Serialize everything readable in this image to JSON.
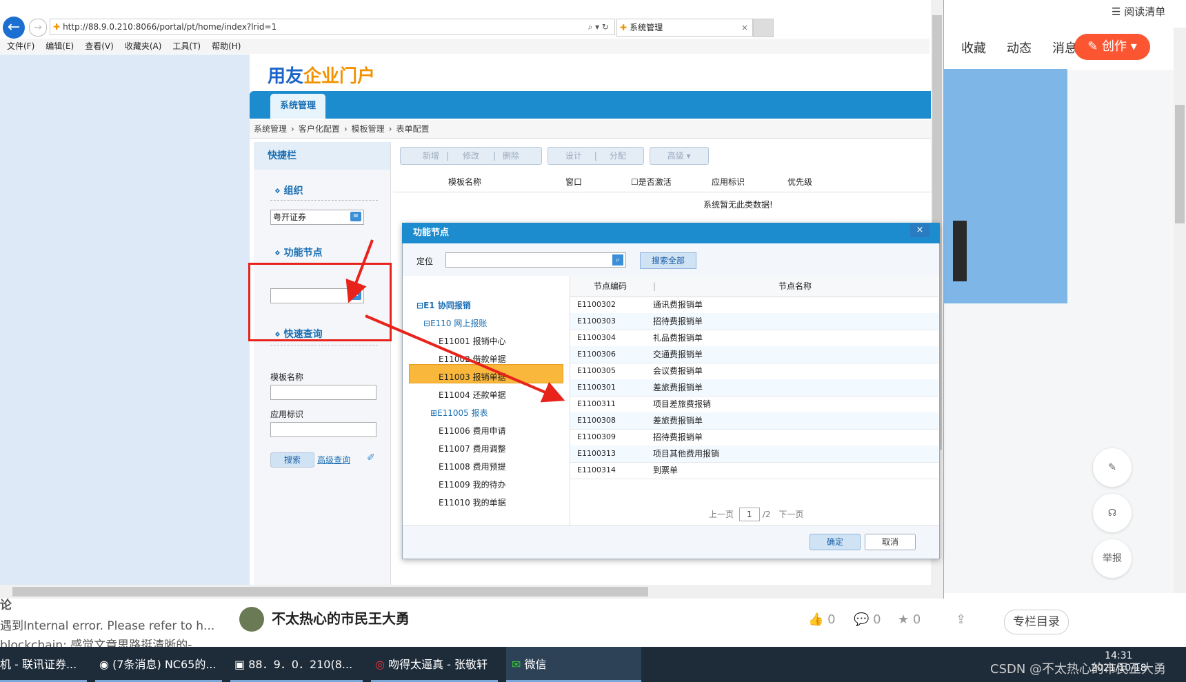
{
  "csdn": {
    "read_list": "阅读清单",
    "nav": [
      "收藏",
      "动态",
      "消息"
    ],
    "create": "创作",
    "report": "举报",
    "left_lines": [
      "遇到Internal error. Please refer to h...",
      "blockchain: 感觉文章思路挺清晰的-",
      "论"
    ],
    "author": "不太热心的市民王大勇",
    "stats": [
      "0",
      "0",
      "0"
    ],
    "column_btn": "专栏目录",
    "watermark": "CSDN @不太热心的市民王大勇"
  },
  "ie": {
    "url": "http://88.9.0.210:8066/portal/pt/home/index?lrid=1",
    "tab_title": "系统管理",
    "menu": [
      "文件(F)",
      "编辑(E)",
      "查看(V)",
      "收藏夹(A)",
      "工具(T)",
      "帮助(H)"
    ]
  },
  "portal": {
    "logo_blue": "用友",
    "logo_orange": "企业门户",
    "tab": "系统管理",
    "breadcrumb": [
      "系统管理",
      "客户化配置",
      "模板管理",
      "表单配置"
    ],
    "quickbar": "快捷栏",
    "org_title": "组织",
    "org_value": "粤开证券",
    "func_title": "功能节点",
    "query_title": "快速查询",
    "tpl_name_label": "模板名称",
    "app_id_label": "应用标识",
    "search_btn": "搜索",
    "advanced_link": "高级查询",
    "toolbar": [
      "新增",
      "修改",
      "删除",
      "设计",
      "分配",
      "高级"
    ],
    "columns": [
      "模板名称",
      "窗口",
      "是否激活",
      "应用标识",
      "优先级"
    ],
    "no_data": "系统暂无此类数据!"
  },
  "dialog": {
    "title": "功能节点",
    "locate_label": "定位",
    "search_all": "搜索全部",
    "tree": [
      {
        "label": "E1 协同报销",
        "level": 0,
        "expanded": true
      },
      {
        "label": "E110 网上报账",
        "level": 1,
        "expanded": true
      },
      {
        "label": "E11001 报销中心",
        "level": 2
      },
      {
        "label": "E11002 借款单据",
        "level": 2
      },
      {
        "label": "E11003 报销单据",
        "level": 2,
        "selected": true
      },
      {
        "label": "E11004 还款单据",
        "level": 2
      },
      {
        "label": "E11005 报表",
        "level": 2,
        "expandable": true
      },
      {
        "label": "E11006 费用申请",
        "level": 2
      },
      {
        "label": "E11007 费用调整",
        "level": 2
      },
      {
        "label": "E11008 费用预提",
        "level": 2
      },
      {
        "label": "E11009 我的待办",
        "level": 2
      },
      {
        "label": "E11010 我的单据",
        "level": 2
      }
    ],
    "grid_headers": [
      "节点编码",
      "节点名称"
    ],
    "rows": [
      [
        "E1100302",
        "通讯费报销单"
      ],
      [
        "E1100303",
        "招待费报销单"
      ],
      [
        "E1100304",
        "礼品费报销单"
      ],
      [
        "E1100306",
        "交通费报销单"
      ],
      [
        "E1100305",
        "会议费报销单"
      ],
      [
        "E1100301",
        "差旅费报销单"
      ],
      [
        "E1100311",
        "项目差旅费报销"
      ],
      [
        "E1100308",
        "差旅费报销单"
      ],
      [
        "E1100309",
        "招待费报销单"
      ],
      [
        "E1100313",
        "项目其他费用报销"
      ],
      [
        "E1100314",
        "到票单"
      ]
    ],
    "pager": {
      "prev": "上一页",
      "page": "1",
      "total": "/2",
      "next": "下一页"
    },
    "ok": "确定",
    "cancel": "取消"
  },
  "taskbar": {
    "items": [
      "机 - 联讯证券...",
      "(7条消息) NC65的...",
      "88．9．0．210(8...",
      "吻得太逼真 - 张敬轩",
      "微信"
    ],
    "time": "14:31",
    "date": "2021/10/18"
  },
  "colors": {
    "accent": "#1d8ccf",
    "selected": "#f9b73b",
    "annotation": "#e8231b",
    "csdn_create": "#fc5531"
  }
}
